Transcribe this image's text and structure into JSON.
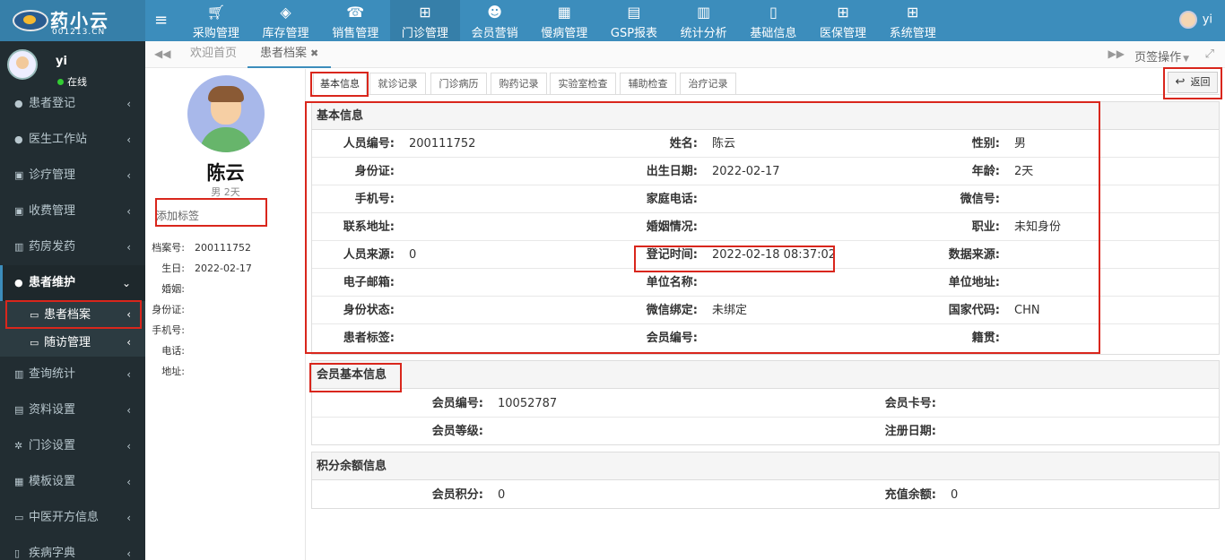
{
  "app": {
    "logo_name": "药小云",
    "logo_sub": "001213.CN",
    "user": "yi"
  },
  "topnav": [
    {
      "label": "采购管理",
      "icon": "cart-icon"
    },
    {
      "label": "库存管理",
      "icon": "cube-icon"
    },
    {
      "label": "销售管理",
      "icon": "phone-icon"
    },
    {
      "label": "门诊管理",
      "icon": "medkit-icon"
    },
    {
      "label": "会员营销",
      "icon": "users-icon"
    },
    {
      "label": "慢病管理",
      "icon": "building-icon"
    },
    {
      "label": "GSP报表",
      "icon": "file-icon"
    },
    {
      "label": "统计分析",
      "icon": "bar-chart-icon"
    },
    {
      "label": "基础信息",
      "icon": "book-icon"
    },
    {
      "label": "医保管理",
      "icon": "windows-icon"
    },
    {
      "label": "系统管理",
      "icon": "windows-icon"
    }
  ],
  "sidebar": {
    "user_name": "yi",
    "status": "在线",
    "items": [
      {
        "label": "患者登记",
        "icon": "user-icon"
      },
      {
        "label": "医生工作站",
        "icon": "user-md-icon"
      },
      {
        "label": "诊疗管理",
        "icon": "medkit-icon"
      },
      {
        "label": "收费管理",
        "icon": "money-icon"
      },
      {
        "label": "药房发药",
        "icon": "map-icon"
      },
      {
        "label": "患者维护",
        "icon": "user-icon"
      },
      {
        "label": "患者档案",
        "icon": "desktop-icon"
      },
      {
        "label": "随访管理",
        "icon": "desktop-icon"
      },
      {
        "label": "查询统计",
        "icon": "bar-chart-icon"
      },
      {
        "label": "资料设置",
        "icon": "file-icon"
      },
      {
        "label": "门诊设置",
        "icon": "cogs-icon"
      },
      {
        "label": "模板设置",
        "icon": "th-icon"
      },
      {
        "label": "中医开方信息",
        "icon": "desktop-icon"
      },
      {
        "label": "疾病字典",
        "icon": "book-icon"
      }
    ]
  },
  "tabbar": {
    "tabs": [
      "欢迎首页",
      "患者档案"
    ],
    "ops": "页签操作"
  },
  "profile": {
    "name": "陈云",
    "sub": "男 2天",
    "tag_placeholder": "添加标签",
    "fields": [
      {
        "k": "档案号:",
        "v": "200111752"
      },
      {
        "k": "生日:",
        "v": "2022-02-17"
      },
      {
        "k": "婚姻:",
        "v": ""
      },
      {
        "k": "身份证:",
        "v": ""
      },
      {
        "k": "手机号:",
        "v": ""
      },
      {
        "k": "电话:",
        "v": ""
      },
      {
        "k": "地址:",
        "v": ""
      }
    ]
  },
  "subtabs": [
    "基本信息",
    "就诊记录",
    "门诊病历",
    "购药记录",
    "实验室检查",
    "辅助检查",
    "治疗记录"
  ],
  "back_label": "返回",
  "basic": {
    "title": "基本信息",
    "rows": [
      [
        {
          "l": "人员编号:",
          "v": "200111752"
        },
        {
          "l": "姓名:",
          "v": "陈云"
        },
        {
          "l": "性别:",
          "v": "男"
        }
      ],
      [
        {
          "l": "身份证:",
          "v": ""
        },
        {
          "l": "出生日期:",
          "v": "2022-02-17"
        },
        {
          "l": "年龄:",
          "v": "2天"
        }
      ],
      [
        {
          "l": "手机号:",
          "v": ""
        },
        {
          "l": "家庭电话:",
          "v": ""
        },
        {
          "l": "微信号:",
          "v": ""
        }
      ],
      [
        {
          "l": "联系地址:",
          "v": ""
        },
        {
          "l": "婚姻情况:",
          "v": ""
        },
        {
          "l": "职业:",
          "v": "未知身份"
        }
      ],
      [
        {
          "l": "人员来源:",
          "v": "0"
        },
        {
          "l": "登记时间:",
          "v": "2022-02-18 08:37:02"
        },
        {
          "l": "数据来源:",
          "v": ""
        }
      ],
      [
        {
          "l": "电子邮箱:",
          "v": ""
        },
        {
          "l": "单位名称:",
          "v": ""
        },
        {
          "l": "单位地址:",
          "v": ""
        }
      ],
      [
        {
          "l": "身份状态:",
          "v": ""
        },
        {
          "l": "微信绑定:",
          "v": "未绑定"
        },
        {
          "l": "国家代码:",
          "v": "CHN"
        }
      ],
      [
        {
          "l": "患者标签:",
          "v": ""
        },
        {
          "l": "会员编号:",
          "v": ""
        },
        {
          "l": "籍贯:",
          "v": ""
        }
      ]
    ]
  },
  "member": {
    "title": "会员基本信息",
    "rows": [
      [
        {
          "l": "会员编号:",
          "v": "10052787"
        },
        {
          "l": "会员卡号:",
          "v": ""
        }
      ],
      [
        {
          "l": "会员等级:",
          "v": ""
        },
        {
          "l": "注册日期:",
          "v": ""
        }
      ]
    ]
  },
  "points": {
    "title": "积分余额信息",
    "rows": [
      [
        {
          "l": "会员积分:",
          "v": "0"
        },
        {
          "l": "充值余额:",
          "v": "0"
        }
      ]
    ]
  },
  "colors": {
    "topbar": "#3c8dbc",
    "sidebar": "#222d32",
    "highlight": "#d9261c"
  }
}
